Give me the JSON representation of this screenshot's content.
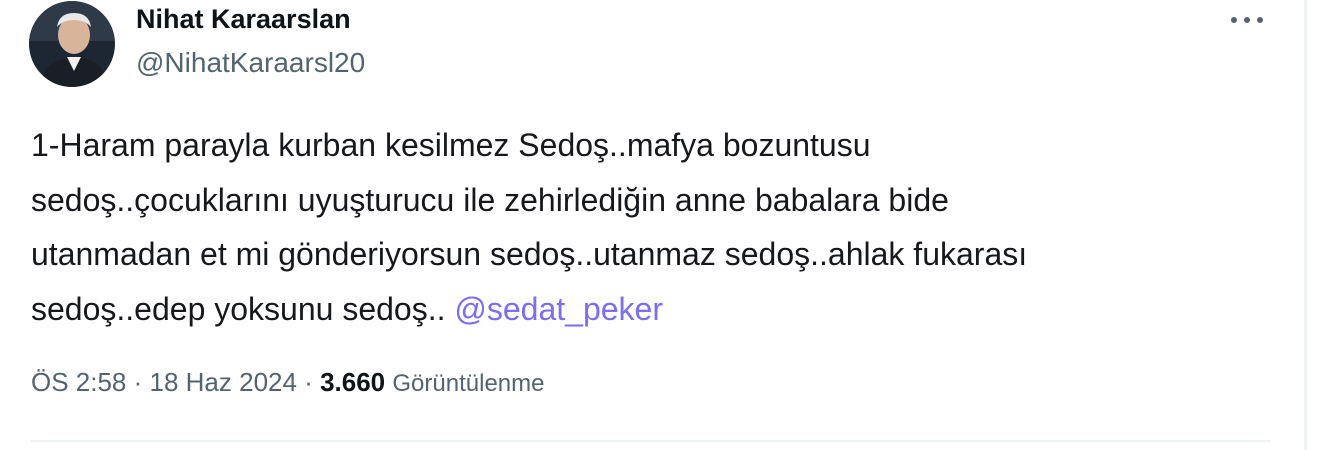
{
  "author": {
    "name": "Nihat Karaarslan",
    "handle": "@NihatKaraarsl20"
  },
  "tweet": {
    "text_before_mention": "1-Haram parayla  kurban kesilmez  Sedoş..mafya bozuntusu\nsedoş..çocuklarını uyuşturucu ile zehirlediğin anne babalara bide\nutanmadan et mi gönderiyorsun sedoş..utanmaz sedoş..ahlak fukarası\nsedoş..edep yoksunu sedoş.. ",
    "mention": "@sedat_peker"
  },
  "meta": {
    "time": "ÖS 2:58",
    "separator": " · ",
    "date": "18 Haz 2024",
    "views_count": "3.660",
    "views_label": "Görüntülenme"
  },
  "icons": {
    "more": "more-horizontal-icon",
    "avatar": "profile-photo"
  },
  "colors": {
    "mention": "#7b6cff",
    "secondary_text": "#536471",
    "primary_text": "#0f1419"
  }
}
